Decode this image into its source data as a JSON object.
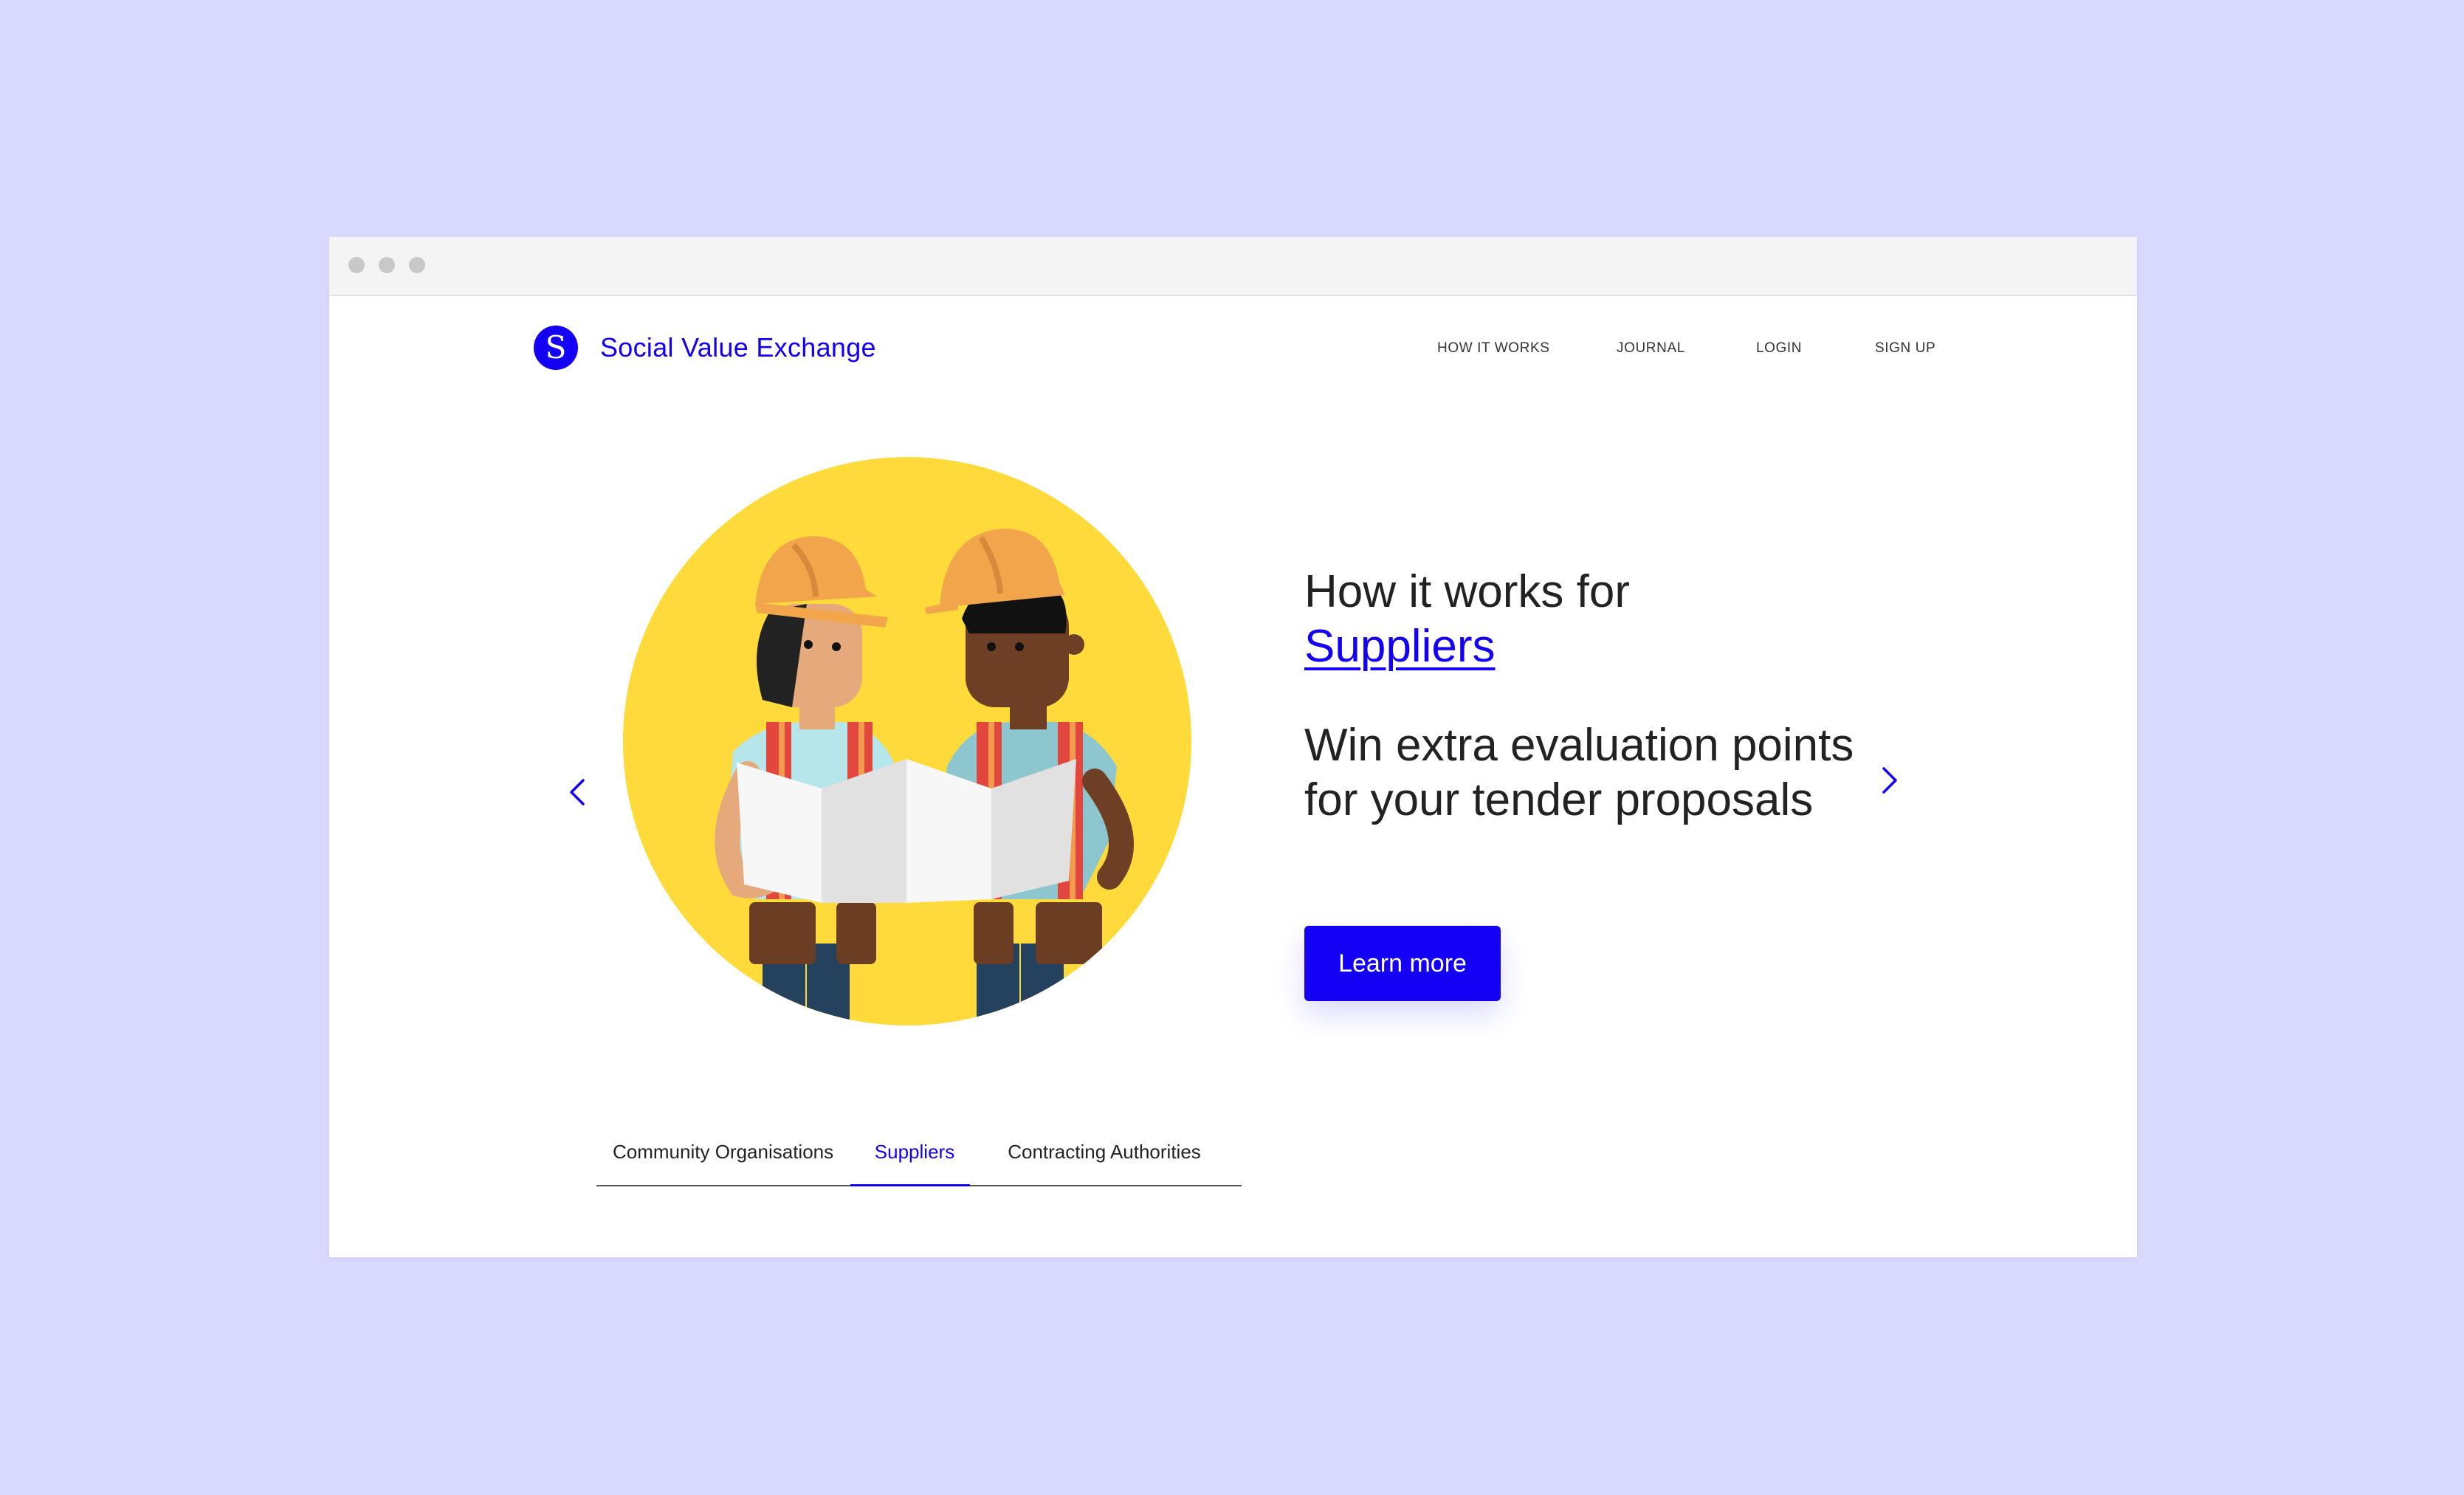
{
  "brand": {
    "name": "Social Value Exchange",
    "primary_color": "#1300f5",
    "background_color": "#d9d8fe"
  },
  "nav": [
    {
      "label": "HOW IT WORKS"
    },
    {
      "label": "JOURNAL"
    },
    {
      "label": "LOGIN"
    },
    {
      "label": "SIGN UP"
    }
  ],
  "hero": {
    "heading": "How it works for",
    "heading_accent": "Suppliers",
    "subheading": "Win extra evaluation points for your tender proposals",
    "cta_label": "Learn more",
    "illustration_icon": "construction-workers-reading-plan-icon"
  },
  "carousel": {
    "prev_icon": "chevron-left-icon",
    "next_icon": "chevron-right-icon"
  },
  "tabs": [
    {
      "label": "Community Organisations",
      "active": false
    },
    {
      "label": "Suppliers",
      "active": true
    },
    {
      "label": "Contracting Authorities",
      "active": false
    }
  ]
}
